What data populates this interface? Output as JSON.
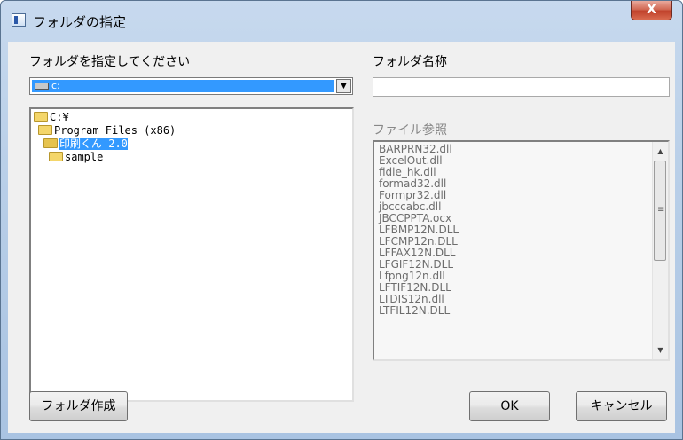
{
  "window": {
    "title": "フォルダの指定",
    "close_label": "X"
  },
  "left": {
    "label": "フォルダを指定してください",
    "drive": "c:",
    "tree": [
      "C:¥",
      "Program Files (x86)",
      "印刷くん 2.0",
      "sample"
    ],
    "selected_index": 2
  },
  "right": {
    "name_label": "フォルダ名称",
    "name_value": "",
    "files_label": "ファイル参照",
    "files": [
      "BARPRN32.dll",
      "ExcelOut.dll",
      "fidle_hk.dll",
      "formad32.dll",
      "Formpr32.dll",
      "jbcccabc.dll",
      "JBCCPPTA.ocx",
      "LFBMP12N.DLL",
      "LFCMP12n.DLL",
      "LFFAX12N.DLL",
      "LFGIF12N.DLL",
      "Lfpng12n.dll",
      "LFTIF12N.DLL",
      "LTDIS12n.dll",
      "LTFIL12N.DLL"
    ]
  },
  "buttons": {
    "create_folder": "フォルダ作成",
    "ok": "OK",
    "cancel": "キャンセル"
  }
}
